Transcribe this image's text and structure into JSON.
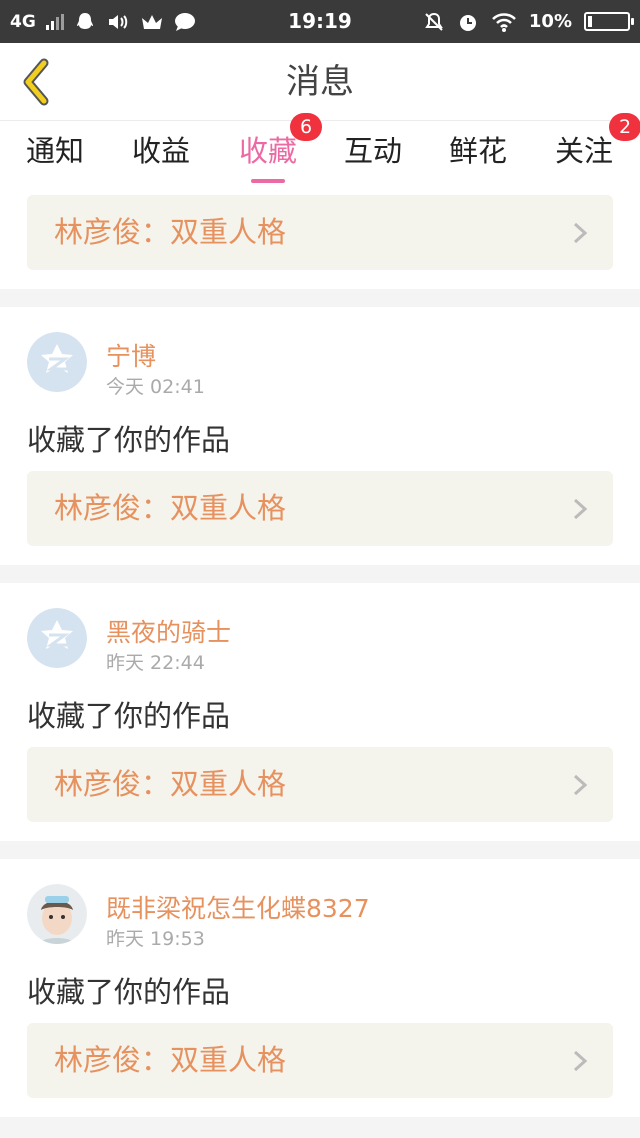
{
  "status_bar": {
    "network": "4G",
    "time": "19:19",
    "battery": "10%",
    "battery_level": 0.1,
    "icons": [
      "qq-icon",
      "volume-icon",
      "crown-icon",
      "chat-icon",
      "mute-bell-icon",
      "alarm-icon",
      "wifi-icon",
      "battery-icon"
    ]
  },
  "header": {
    "title": "消息",
    "back_icon": "chevron-left-icon"
  },
  "tabs": [
    {
      "label": "通知",
      "badge": ""
    },
    {
      "label": "收益",
      "badge": ""
    },
    {
      "label": "收藏",
      "badge": "6",
      "active": true
    },
    {
      "label": "互动",
      "badge": ""
    },
    {
      "label": "鲜花",
      "badge": ""
    },
    {
      "label": "关注",
      "badge": "2"
    }
  ],
  "top_item": {
    "work_title": "林彦俊：双重人格"
  },
  "messages": [
    {
      "username": "宁博",
      "time": "今天 02:41",
      "text": "收藏了你的作品",
      "work_title": "林彦俊：双重人格",
      "avatar": "default-avatar-icon"
    },
    {
      "username": "黑夜的骑士",
      "time": "昨天 22:44",
      "text": "收藏了你的作品",
      "work_title": "林彦俊：双重人格",
      "avatar": "default-avatar-icon"
    },
    {
      "username": "既非梁祝怎生化蝶8327",
      "time": "昨天 19:53",
      "text": "收藏了你的作品",
      "work_title": "林彦俊：双重人格",
      "avatar": "user-photo-avatar"
    }
  ],
  "colors": {
    "accent_pink": "#ec6aa3",
    "name_orange": "#e6915e",
    "badge_red": "#f0323f",
    "back_yellow": "#f2cf1e"
  }
}
